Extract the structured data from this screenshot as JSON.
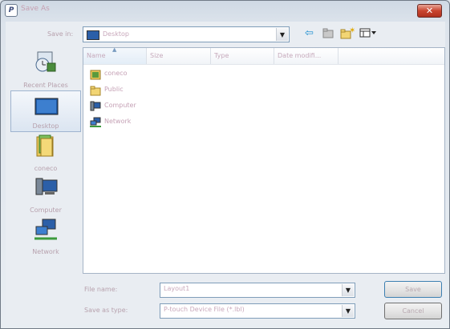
{
  "window": {
    "title": "Save As",
    "close_symbol": "✕"
  },
  "save_in": {
    "label": "Save in:",
    "value": "Desktop"
  },
  "toolbar": {
    "back_icon": "back-arrow-icon",
    "up_icon": "up-folder-icon",
    "new_folder_icon": "new-folder-icon",
    "views_icon": "views-menu-icon"
  },
  "places": [
    {
      "label": "Recent Places",
      "icon": "recent-places-icon"
    },
    {
      "label": "Desktop",
      "icon": "desktop-icon"
    },
    {
      "label": "coneco",
      "icon": "user-folder-icon"
    },
    {
      "label": "Computer",
      "icon": "computer-icon"
    },
    {
      "label": "Network",
      "icon": "network-icon"
    }
  ],
  "columns": [
    "Name",
    "Size",
    "Type",
    "Date modifi..."
  ],
  "files": [
    {
      "name": "coneco",
      "icon": "user-folder-icon"
    },
    {
      "name": "Public",
      "icon": "folder-icon"
    },
    {
      "name": "Computer",
      "icon": "computer-icon"
    },
    {
      "name": "Network",
      "icon": "network-icon"
    }
  ],
  "file_name": {
    "label": "File name:",
    "value": "Layout1"
  },
  "save_as_type": {
    "label": "Save as type:",
    "value": "P-touch Device File (*.lbl)"
  },
  "buttons": {
    "save": "Save",
    "cancel": "Cancel"
  }
}
